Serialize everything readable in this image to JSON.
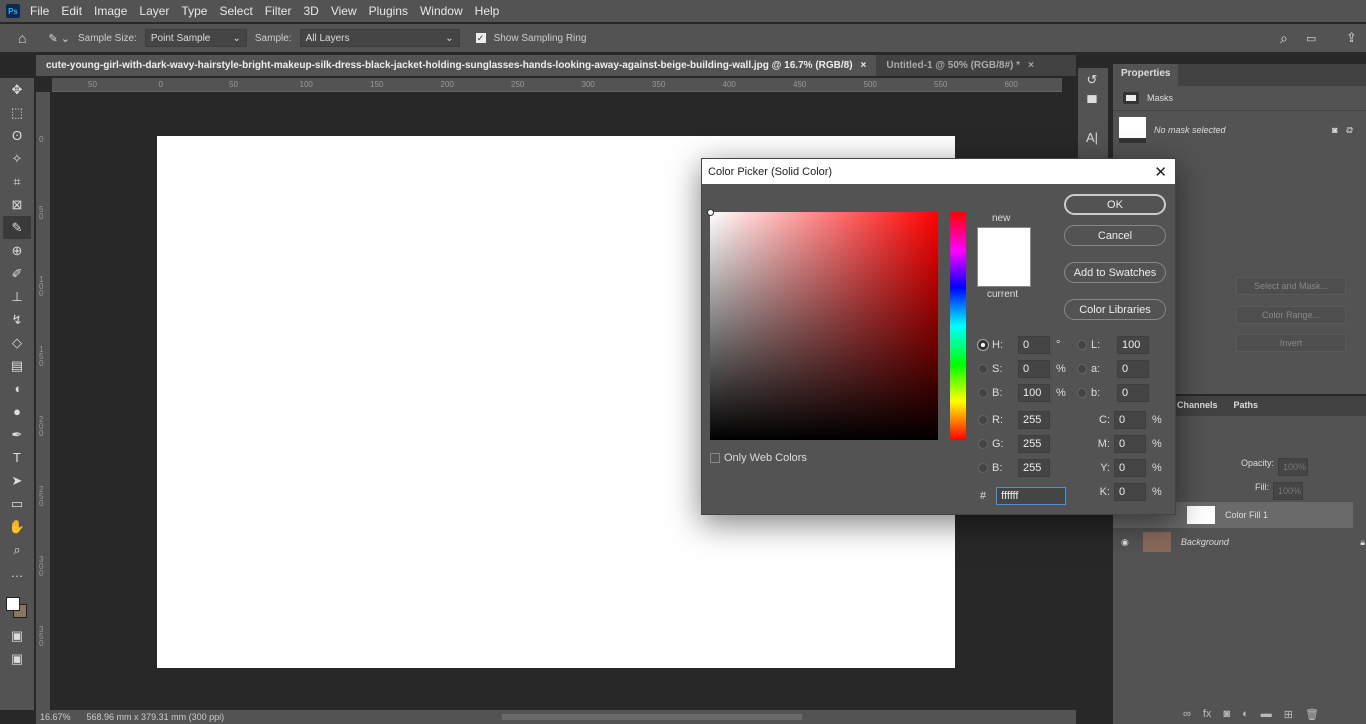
{
  "app": {
    "logo": "Ps"
  },
  "menu": [
    "File",
    "Edit",
    "Image",
    "Layer",
    "Type",
    "Select",
    "Filter",
    "3D",
    "View",
    "Plugins",
    "Window",
    "Help"
  ],
  "options": {
    "sample_size_label": "Sample Size:",
    "sample_size": "Point Sample",
    "sample_label": "Sample:",
    "sample": "All Layers",
    "sampling_ring": "Show Sampling Ring",
    "sampling_ring_checked": true
  },
  "tabs": [
    {
      "label": "cute-young-girl-with-dark-wavy-hairstyle-bright-makeup-silk-dress-black-jacket-holding-sunglasses-hands-looking-away-against-beige-building-wall.jpg @ 16.7% (RGB/8)",
      "active": true
    },
    {
      "label": "Untitled-1 @ 50% (RGB/8#) *",
      "active": false
    }
  ],
  "ruler_h": [
    "50",
    "0",
    "50",
    "100",
    "150",
    "200",
    "250",
    "300",
    "350",
    "400",
    "450",
    "500",
    "550",
    "600"
  ],
  "ruler_v": [
    "0",
    "50",
    "100",
    "150",
    "200",
    "250",
    "300",
    "350"
  ],
  "status": {
    "zoom": "16.67%",
    "size": "568.96 mm x 379.31 mm (300 ppi)"
  },
  "dialog": {
    "title": "Color Picker (Solid Color)",
    "new_label": "new",
    "current_label": "current",
    "ok": "OK",
    "cancel": "Cancel",
    "add_swatches": "Add to Swatches",
    "color_libraries": "Color Libraries",
    "only_web": "Only Web Colors",
    "hex_label": "#",
    "hex": "ffffff",
    "new_color": "#ffffff",
    "current_color": "#ffffff",
    "hsb": [
      {
        "label": "H:",
        "value": "0",
        "unit": "°",
        "selected": true
      },
      {
        "label": "S:",
        "value": "0",
        "unit": "%"
      },
      {
        "label": "B:",
        "value": "100",
        "unit": "%"
      }
    ],
    "rgb": [
      {
        "label": "R:",
        "value": "255"
      },
      {
        "label": "G:",
        "value": "255"
      },
      {
        "label": "B:",
        "value": "255"
      }
    ],
    "lab": [
      {
        "label": "L:",
        "value": "100"
      },
      {
        "label": "a:",
        "value": "0"
      },
      {
        "label": "b:",
        "value": "0"
      }
    ],
    "cmyk": [
      {
        "label": "C:",
        "value": "0",
        "unit": "%"
      },
      {
        "label": "M:",
        "value": "0",
        "unit": "%"
      },
      {
        "label": "Y:",
        "value": "0",
        "unit": "%"
      },
      {
        "label": "K:",
        "value": "0",
        "unit": "%"
      }
    ]
  },
  "properties": {
    "title": "Properties",
    "masks": "Masks",
    "no_mask": "No mask selected",
    "select_mask": "Select and Mask...",
    "color_range": "Color Range...",
    "invert": "Invert"
  },
  "layers": {
    "tabs": [
      "Channels",
      "Paths"
    ],
    "opacity_label": "Opacity:",
    "opacity": "100%",
    "fill_label": "Fill:",
    "fill": "100%",
    "items": [
      {
        "name": "Color Fill 1",
        "selected": true
      },
      {
        "name": "Background",
        "locked": true
      }
    ]
  }
}
